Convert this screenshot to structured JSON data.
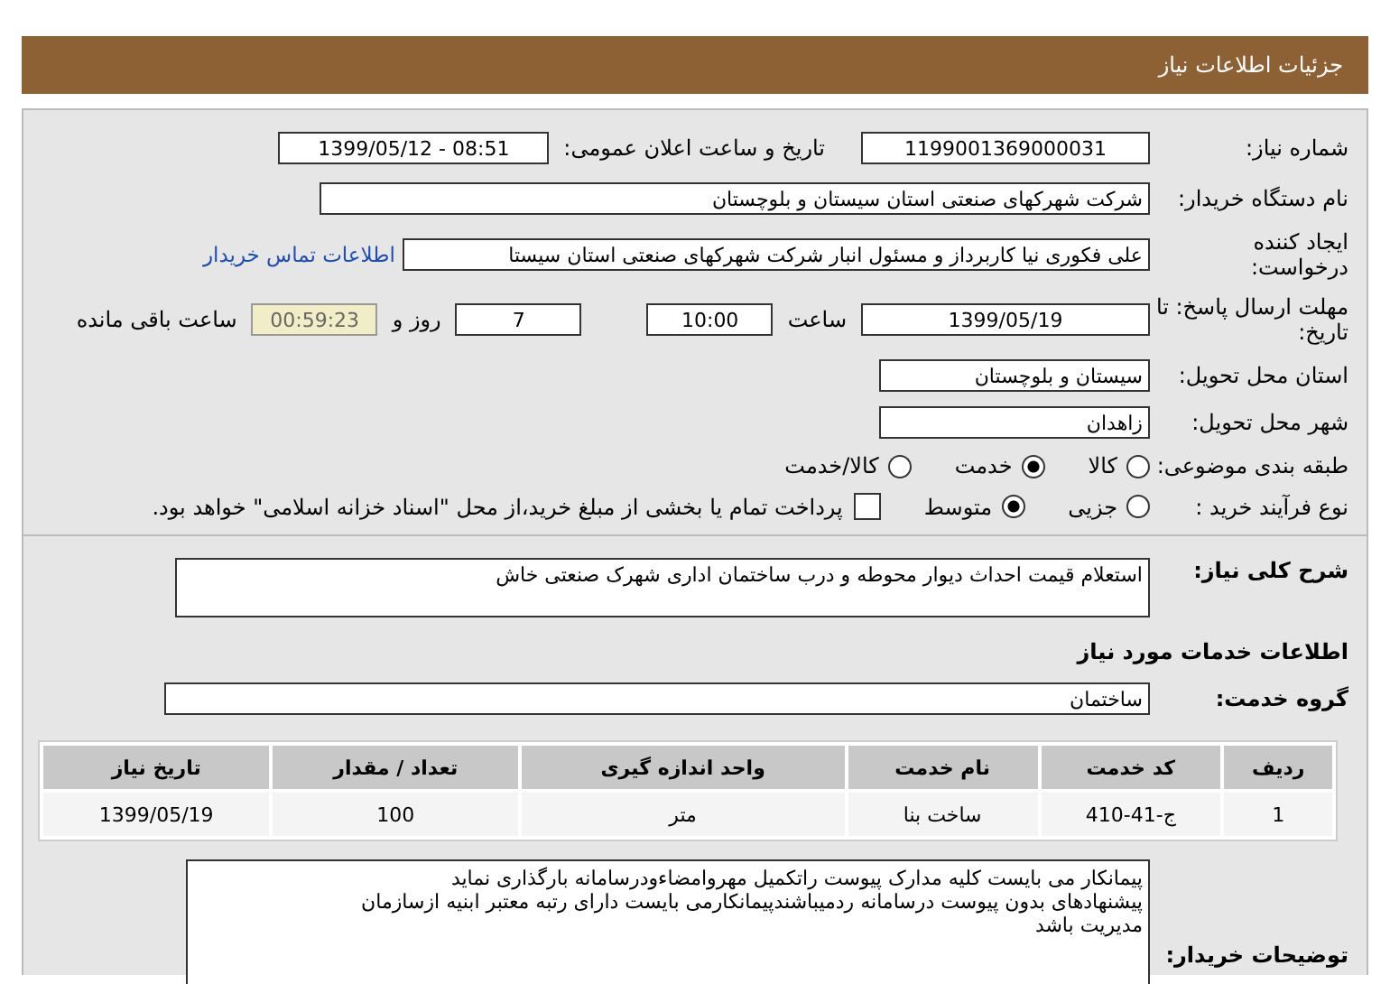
{
  "header": {
    "title": "جزئیات اطلاعات نیاز"
  },
  "need_number": {
    "label": "شماره نیاز:",
    "value": "1199001369000031"
  },
  "announce": {
    "label": "تاریخ و ساعت اعلان عمومی:",
    "value": "1399/05/12 - 08:51"
  },
  "buyer_org": {
    "label": "نام دستگاه خریدار:",
    "value": "شرکت شهرکهای صنعتی استان سیستان و بلوچستان"
  },
  "creator": {
    "label": "ایجاد کننده درخواست:",
    "value": "علی  فکوری نیا کاربرداز و مسئول انبار شرکت شهرکهای صنعتی استان سیستا",
    "link": "اطلاعات تماس خریدار"
  },
  "deadline": {
    "label": "مهلت ارسال پاسخ: تا تاریخ:",
    "date": "1399/05/19",
    "time_label": "ساعت",
    "time": "10:00",
    "days": "7",
    "days_label": "روز و",
    "remaining": "00:59:23",
    "remaining_label": "ساعت باقی مانده"
  },
  "province": {
    "label": "استان محل تحویل:",
    "value": "سیستان و بلوچستان"
  },
  "city": {
    "label": "شهر محل تحویل:",
    "value": "زاهدان"
  },
  "category": {
    "label": "طبقه بندی موضوعی:",
    "options": [
      {
        "label": "کالا",
        "selected": false
      },
      {
        "label": "خدمت",
        "selected": true
      },
      {
        "label": "کالا/خدمت",
        "selected": false
      }
    ]
  },
  "process": {
    "label": "نوع فرآیند خرید :",
    "options": [
      {
        "label": "جزیی",
        "selected": false
      },
      {
        "label": "متوسط",
        "selected": true
      }
    ],
    "payment": {
      "checked": false,
      "text": "پرداخت تمام یا بخشی از مبلغ خرید،از محل \"اسناد خزانه اسلامی\" خواهد بود."
    }
  },
  "summary": {
    "label": "شرح کلی نیاز:",
    "value": "استعلام قیمت احداث دیوار محوطه و درب ساختمان اداری شهرک صنعتی خاش"
  },
  "services_title": "اطلاعات خدمات مورد نیاز",
  "service_group": {
    "label": "گروه خدمت:",
    "value": "ساختمان"
  },
  "table": {
    "columns": [
      "ردیف",
      "کد خدمت",
      "نام خدمت",
      "واحد اندازه گیری",
      "تعداد / مقدار",
      "تاریخ نیاز"
    ],
    "rows": [
      [
        "1",
        "ج-41-410",
        "ساخت بنا",
        "متر",
        "100",
        "1399/05/19"
      ]
    ]
  },
  "notes": {
    "label": "توضیحات خریدار:",
    "lines": [
      "پیمانکار می بایست کلیه مدارک پیوست راتکمیل مهروامضاءودرسامانه بارگذاری نماید",
      "پیشنهادهای بدون پیوست  درسامانه ردمیباشندپیمانکارمی بایست دارای رتبه معتبر ابنیه ازسازمان",
      "مدیریت باشد"
    ]
  }
}
